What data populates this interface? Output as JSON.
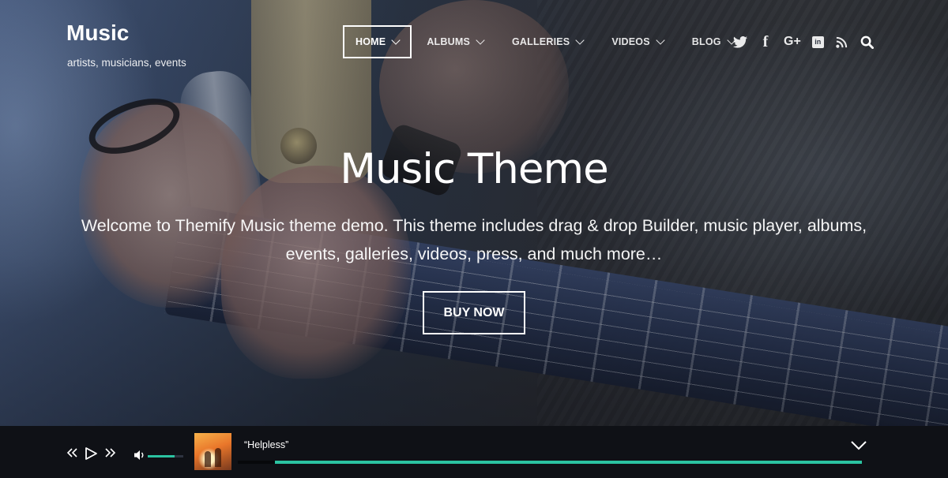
{
  "site": {
    "title": "Music",
    "tagline": "artists, musicians, events"
  },
  "nav": {
    "items": [
      {
        "label": "HOME",
        "active": true
      },
      {
        "label": "ALBUMS",
        "active": false
      },
      {
        "label": "GALLERIES",
        "active": false
      },
      {
        "label": "VIDEOS",
        "active": false
      },
      {
        "label": "BLOG",
        "active": false
      }
    ]
  },
  "social": {
    "icons": [
      "twitter-icon",
      "facebook-icon",
      "google-plus-icon",
      "linkedin-icon",
      "rss-icon",
      "search-icon"
    ],
    "glyphs": {
      "facebook": "f",
      "google_plus": "G+",
      "linkedin": "in"
    }
  },
  "hero": {
    "title": "Music Theme",
    "description": "Welcome to Themify Music theme demo. This theme includes drag & drop Builder, music player, albums, events, galleries, videos, press, and much more…",
    "button_label": "BUY NOW"
  },
  "player": {
    "track_title": "“Helpless”",
    "volume_level": 0.75,
    "progress_fraction": 1.0,
    "controls": [
      "previous-icon",
      "play-icon",
      "next-icon",
      "volume-icon",
      "chevron-down-icon"
    ],
    "accent_color": "#2bc3a1",
    "background_color": "#0f1116"
  }
}
